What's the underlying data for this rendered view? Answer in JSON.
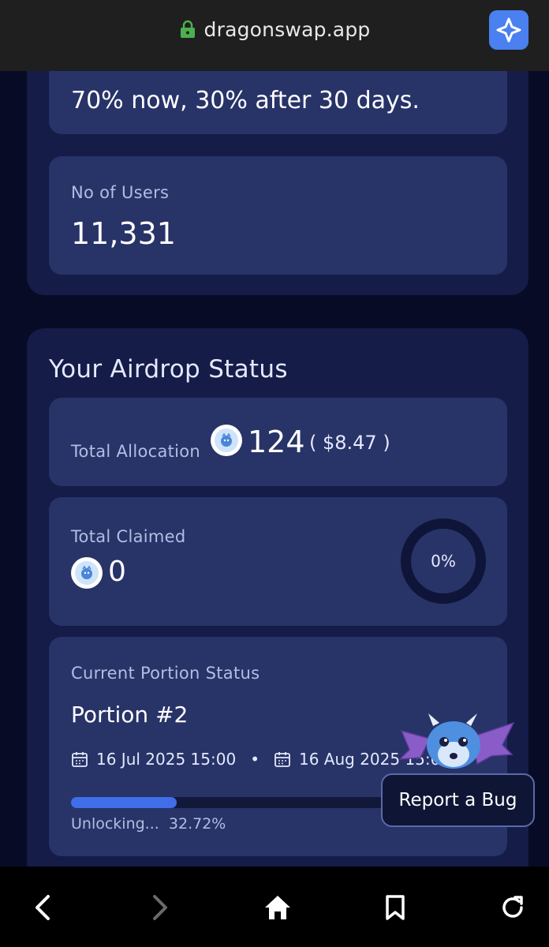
{
  "browser": {
    "url": "dragonswap.app",
    "icons": {
      "lock": "lock-icon",
      "extension": "extension-sparkle-icon"
    }
  },
  "distribution": {
    "split_value": "70% now, 30% after 30 days.",
    "users_label": "No of Users",
    "users_value": "11,331"
  },
  "airdrop": {
    "title": "Your Airdrop Status",
    "total_allocation": {
      "label": "Total Allocation",
      "amount": "124",
      "usd": "( $8.47 )"
    },
    "total_claimed": {
      "label": "Total Claimed",
      "amount": "0",
      "percent_text": "0%",
      "percent": 0
    },
    "portion": {
      "label": "Current Portion Status",
      "name": "Portion #2",
      "start": "16 Jul 2025 15:00",
      "separator": "•",
      "end": "16 Aug 2025 15:00",
      "unlocking_label": "Unlocking...",
      "unlocking_value": "32.72%",
      "progress": 0.3272
    }
  },
  "report_bug": {
    "label": "Report a Bug"
  },
  "bottom_nav": [
    "back-icon",
    "forward-icon",
    "home-icon",
    "bookmark-icon",
    "reload-icon"
  ],
  "colors": {
    "accent": "#3f6ee8",
    "card": "#283368",
    "section": "#151c48",
    "background": "#070b25"
  }
}
